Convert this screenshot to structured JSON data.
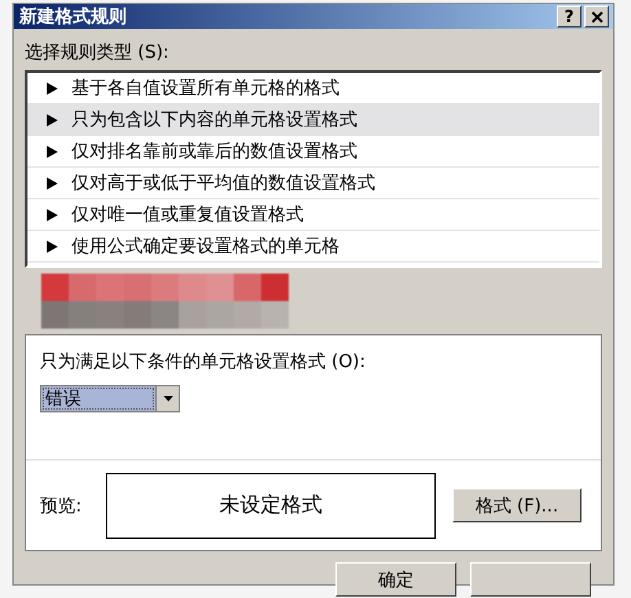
{
  "window": {
    "title": "新建格式规则",
    "help_button": "?"
  },
  "rule_type_label": "选择规则类型 (S):",
  "rule_types": [
    {
      "label": "基于各自值设置所有单元格的格式",
      "selected": false
    },
    {
      "label": "只为包含以下内容的单元格设置格式",
      "selected": true
    },
    {
      "label": "仅对排名靠前或靠后的数值设置格式",
      "selected": false
    },
    {
      "label": "仅对高于或低于平均值的数值设置格式",
      "selected": false
    },
    {
      "label": "仅对唯一值或重复值设置格式",
      "selected": false
    },
    {
      "label": "使用公式确定要设置格式的单元格",
      "selected": false
    }
  ],
  "condition_label": "只为满足以下条件的单元格设置格式 (O):",
  "condition_dropdown": {
    "value": "错误"
  },
  "preview": {
    "label": "预览:",
    "text": "未设定格式"
  },
  "format_button": "格式 (F)...",
  "buttons": [
    "确定"
  ]
}
